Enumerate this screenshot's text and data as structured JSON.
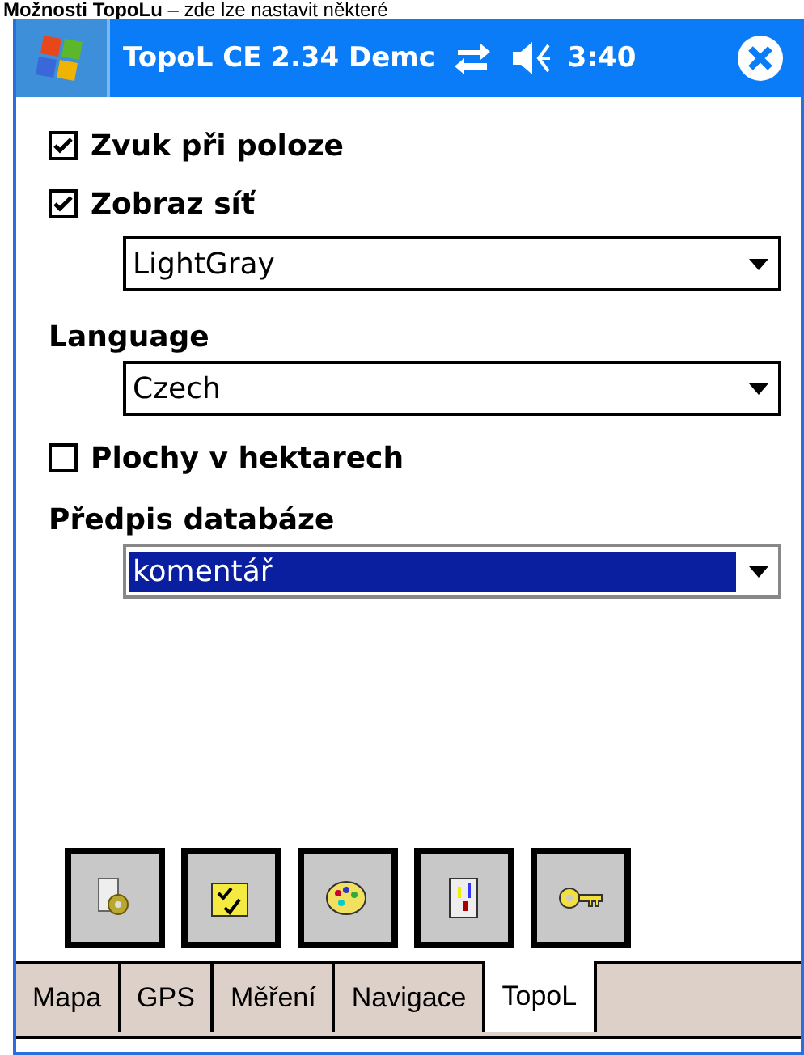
{
  "caption": "**Možnosti TopoLu** – zde lze nastavit některé",
  "title_bar": {
    "title": "TopoL CE 2.34 Demc",
    "time": "3:40"
  },
  "settings": [
    {
      "kind": "checkbox",
      "label": "Zvuk při poloze",
      "checked": true
    },
    {
      "kind": "checkbox",
      "label": "Zobraz síť",
      "checked": true
    },
    {
      "kind": "dropdown",
      "value": "LightGray",
      "selected": false
    },
    {
      "kind": "heading",
      "label": "Language"
    },
    {
      "kind": "dropdown",
      "value": "Czech",
      "selected": false
    },
    {
      "kind": "checkbox",
      "label": "Plochy v hektarech",
      "checked": false
    },
    {
      "kind": "heading",
      "label": "Předpis databáze"
    },
    {
      "kind": "dropdown",
      "value": "komentář",
      "selected": true
    }
  ],
  "tabs": [
    {
      "label": "Mapa",
      "selected": false
    },
    {
      "label": "GPS",
      "selected": false
    },
    {
      "label": "Měření",
      "selected": false
    },
    {
      "label": "Navigace",
      "selected": false
    },
    {
      "label": "TopoL",
      "selected": true
    }
  ]
}
